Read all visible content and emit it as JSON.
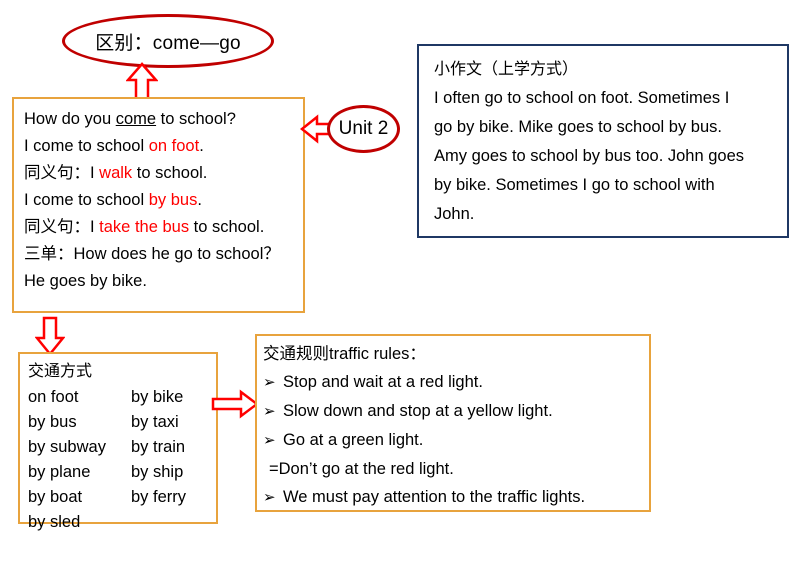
{
  "diff_ellipse": {
    "label": "区别：come—go"
  },
  "unit_ellipse": {
    "label": "Unit 2"
  },
  "main_box": {
    "lines": [
      {
        "id": "q1",
        "pre": "How do you ",
        "underline": "come",
        "post": " to school?"
      },
      {
        "id": "a1",
        "pre": "I come to school ",
        "red": "on foot",
        "post": "."
      },
      {
        "id": "syn1",
        "pre": "同义句：I ",
        "red": "walk",
        "post": " to school."
      },
      {
        "id": "a2",
        "pre": "I come to school ",
        "red": "by bus",
        "post": "."
      },
      {
        "id": "syn2",
        "pre": "同义句：I ",
        "red": "take the bus",
        "post": " to school."
      },
      {
        "id": "third",
        "pre": "三单：How does he go to school？",
        "red": "",
        "post": ""
      },
      {
        "id": "a3",
        "pre": "He goes by bike.",
        "red": "",
        "post": ""
      }
    ]
  },
  "essay_box": {
    "heading": "小作文（上学方式）",
    "body_lines": [
      "I often go to school on foot. Sometimes I",
      "go by bike. Mike goes to school by bus.",
      "Amy goes to school by bus too. John goes",
      "by bike. Sometimes I go to school with",
      "John."
    ]
  },
  "transport_box": {
    "heading": "交通方式",
    "rows": [
      {
        "left": "on foot",
        "right": "by bike"
      },
      {
        "left": "by bus",
        "right": "by taxi"
      },
      {
        "left": "by subway",
        "right": "by train"
      },
      {
        "left": "by plane",
        "right": "by ship"
      },
      {
        "left": "by boat",
        "right": " by ferry"
      },
      {
        "left": "by sled",
        "right": ""
      }
    ]
  },
  "rules_box": {
    "heading": "交通规则traffic rules：",
    "bullet_glyph": "➢",
    "rules": [
      {
        "bulleted": true,
        "text": "Stop and wait at a red light."
      },
      {
        "bulleted": true,
        "text": "Slow down and stop at a yellow light."
      },
      {
        "bulleted": true,
        "text": "Go at a green light."
      },
      {
        "bulleted": false,
        "text": "=Don’t go at the red light."
      },
      {
        "bulleted": true,
        "text": "We must pay attention to the traffic lights."
      }
    ]
  },
  "arrows": {
    "up_to_ellipse": "arrow-up",
    "left_to_main": "arrow-left",
    "down_to_transport": "arrow-down",
    "right_to_rules": "arrow-right"
  },
  "colors": {
    "orange_border": "#E8A33D",
    "blue_border": "#1F3864",
    "red_accent": "#C00000",
    "red_text": "#FF0000"
  }
}
